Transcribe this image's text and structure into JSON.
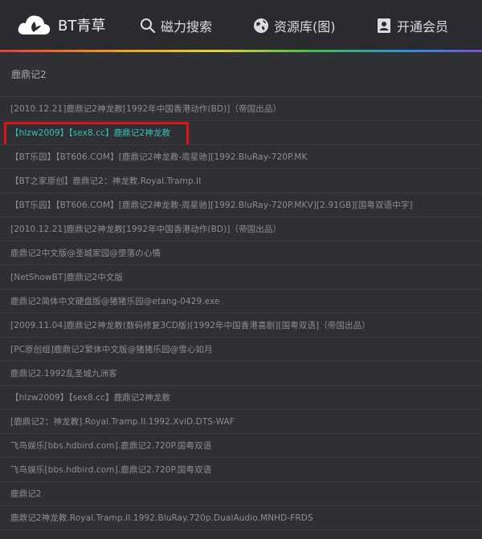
{
  "header": {
    "logo_text": "BT青草",
    "nav": [
      {
        "label": "磁力搜索",
        "icon": "search-icon"
      },
      {
        "label": "资源库(图)",
        "icon": "globe-icon"
      },
      {
        "label": "开通会员",
        "icon": "user-card-icon"
      }
    ]
  },
  "page_title": "鹿鼎记2",
  "results": [
    "[2010.12.21]鹿鼎记2神龙教[1992年中国香港动作(BD)]（帝国出品）",
    "【hlzw2009】【sex8.cc】鹿鼎记2神龙教",
    "【BT乐园】【BT606.COM】[鹿鼎记2神龙教-周星驰][1992.BluRay-720P.MK",
    "【BT之家原创】鹿鼎记2：神龙教.Royal.Tramp.II",
    "【BT乐园】【BT606.COM】[鹿鼎记2神龙教-周星驰][1992.BluRay-720P.MKV][2.91GB][国粤双语中字]",
    "[2010.12.21]鹿鼎记2神龙教[1992年中国香港动作(BD)]（帝国出品）",
    "鹿鼎记2中文版@圣城家园@堕落の心情",
    "[NetShowBT]鹿鼎记2中文版",
    "鹿鼎记2简体中文硬盘版@猪猪乐园@etang-0429.exe",
    "[2009.11.04]鹿鼎记2神龙教(数码修复3CD版)[1992年中国香港喜剧][国粤双语]（帝国出品）",
    "[PC原创组]鹿鼎记2繁体中文版@猪猪乐园@雪心如月",
    "鹿鼎记2.1992乱圣城九洲客",
    "【hlzw2009】【sex8.cc】鹿鼎记2神龙教",
    "[鹿鼎记2：神龙教].Royal.Tramp.II.1992.XviD.DTS-WAF",
    "飞鸟娱乐[bbs.hdbird.com].鹿鼎记2.720P.国粤双语",
    "飞鸟娱乐[bbs.hdbird.com].鹿鼎记2.720P.国粤双语",
    "鹿鼎记2",
    "鹿鼎记2神龙教.Royal.Tramp.II.1992.BluRay.720p.DualAudio.MNHD-FRDS"
  ],
  "colors": {
    "highlight_text": "#33c2b8",
    "highlight_box": "#e0141e"
  }
}
